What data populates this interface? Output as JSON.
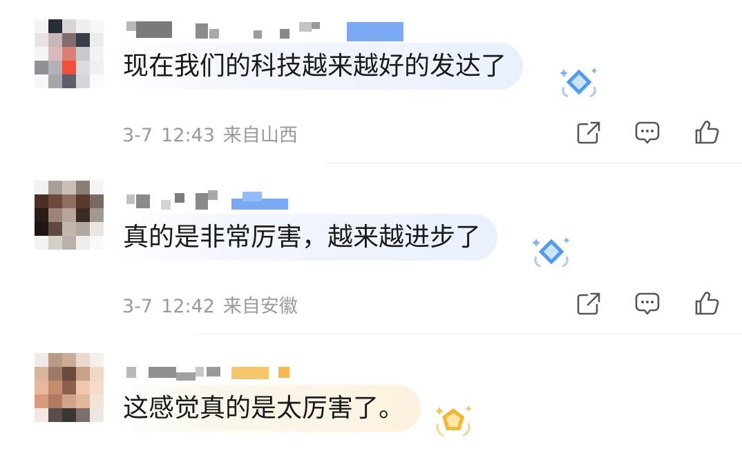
{
  "comments": [
    {
      "text": "现在我们的科技越来越好的发达了",
      "date": "3-7",
      "time": "12:43",
      "location": "来自山西",
      "badge": "diamond-badge-icon"
    },
    {
      "text": "真的是非常厉害，越来越进步了",
      "date": "3-7",
      "time": "12:42",
      "location": "来自安徽",
      "badge": "diamond-badge-icon"
    },
    {
      "text": "这感觉真的是太厉害了。",
      "badge": "gold-badge-icon"
    }
  ],
  "icons": {
    "share": "share-icon",
    "comment": "comment-icon",
    "like": "thumbs-up-icon"
  },
  "colors": {
    "meta_text": "#9a9a9a",
    "bubble_blue": "#eaf1fd",
    "bubble_gold": "#fcf2de",
    "badge_blue": "#4d9bf5",
    "badge_gold": "#f7b733"
  }
}
